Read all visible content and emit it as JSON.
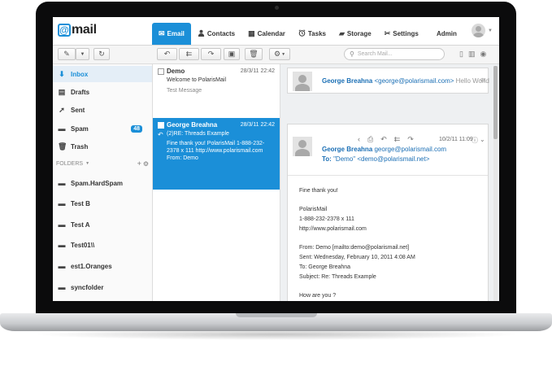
{
  "app": {
    "logo_mark": "@",
    "logo_text": "mail"
  },
  "nav": {
    "tabs": [
      {
        "label": "Email",
        "icon": "envelope-icon",
        "glyph": "✉"
      },
      {
        "label": "Contacts",
        "icon": "person-icon",
        "glyph": "👤"
      },
      {
        "label": "Calendar",
        "icon": "calendar-icon",
        "glyph": "▦"
      },
      {
        "label": "Tasks",
        "icon": "alarm-icon",
        "glyph": "⏰"
      },
      {
        "label": "Storage",
        "icon": "storage-icon",
        "glyph": "▰"
      },
      {
        "label": "Settings",
        "icon": "tools-icon",
        "glyph": "✂"
      }
    ],
    "admin": "Admin"
  },
  "toolbar": {
    "search_placeholder": "Search Mail..."
  },
  "sidebar": {
    "items": [
      {
        "label": "Inbox",
        "glyph": "⬇"
      },
      {
        "label": "Drafts",
        "glyph": "▤"
      },
      {
        "label": "Sent",
        "glyph": "➚"
      },
      {
        "label": "Spam",
        "glyph": "▬",
        "badge": "48"
      },
      {
        "label": "Trash",
        "glyph": "🗑"
      }
    ],
    "folders_label": "FOLDERS",
    "folders": [
      {
        "label": "Spam.HardSpam"
      },
      {
        "label": "Test B"
      },
      {
        "label": "Test A"
      },
      {
        "label": "Test01\\\\"
      },
      {
        "label": "est1.Oranges"
      },
      {
        "label": "syncfolder"
      }
    ]
  },
  "messages": [
    {
      "from": "Demo",
      "date": "28/3/11 22:42",
      "subject": "Welcome to PolarisMail",
      "preview": "Test Message"
    },
    {
      "from": "George Breahna",
      "date": "28/3/11 22:42",
      "subject": "(2)RE: Threads Example",
      "preview_1": "Fine thank you! PolarisMail 1-888-232-",
      "preview_2": "2378 x 111 http://www.polarismail.com",
      "preview_3": "From: Demo"
    }
  ],
  "reading": {
    "collapsed": {
      "name": "George Breahna",
      "email": "<george@polarismail.com>",
      "snippet": "Hello World"
    },
    "expanded": {
      "date": "10/2/11 11:09",
      "name": "George Breahna",
      "email": "george@polarismail.com",
      "to_label": "To:",
      "to_value": "\"Demo\" <demo@polarismail.net>",
      "body": [
        "Fine thank you!",
        "",
        "PolarisMail",
        "1-888-232-2378 x 111",
        "http://www.polarismail.com",
        "",
        "From: Demo [mailto:demo@polarismail.net]",
        "Sent: Wednesday, February 10, 2011 4:08 AM",
        "To: George Breahna",
        "Subject: Re: Threads Example",
        "",
        "How are you ?"
      ]
    }
  }
}
